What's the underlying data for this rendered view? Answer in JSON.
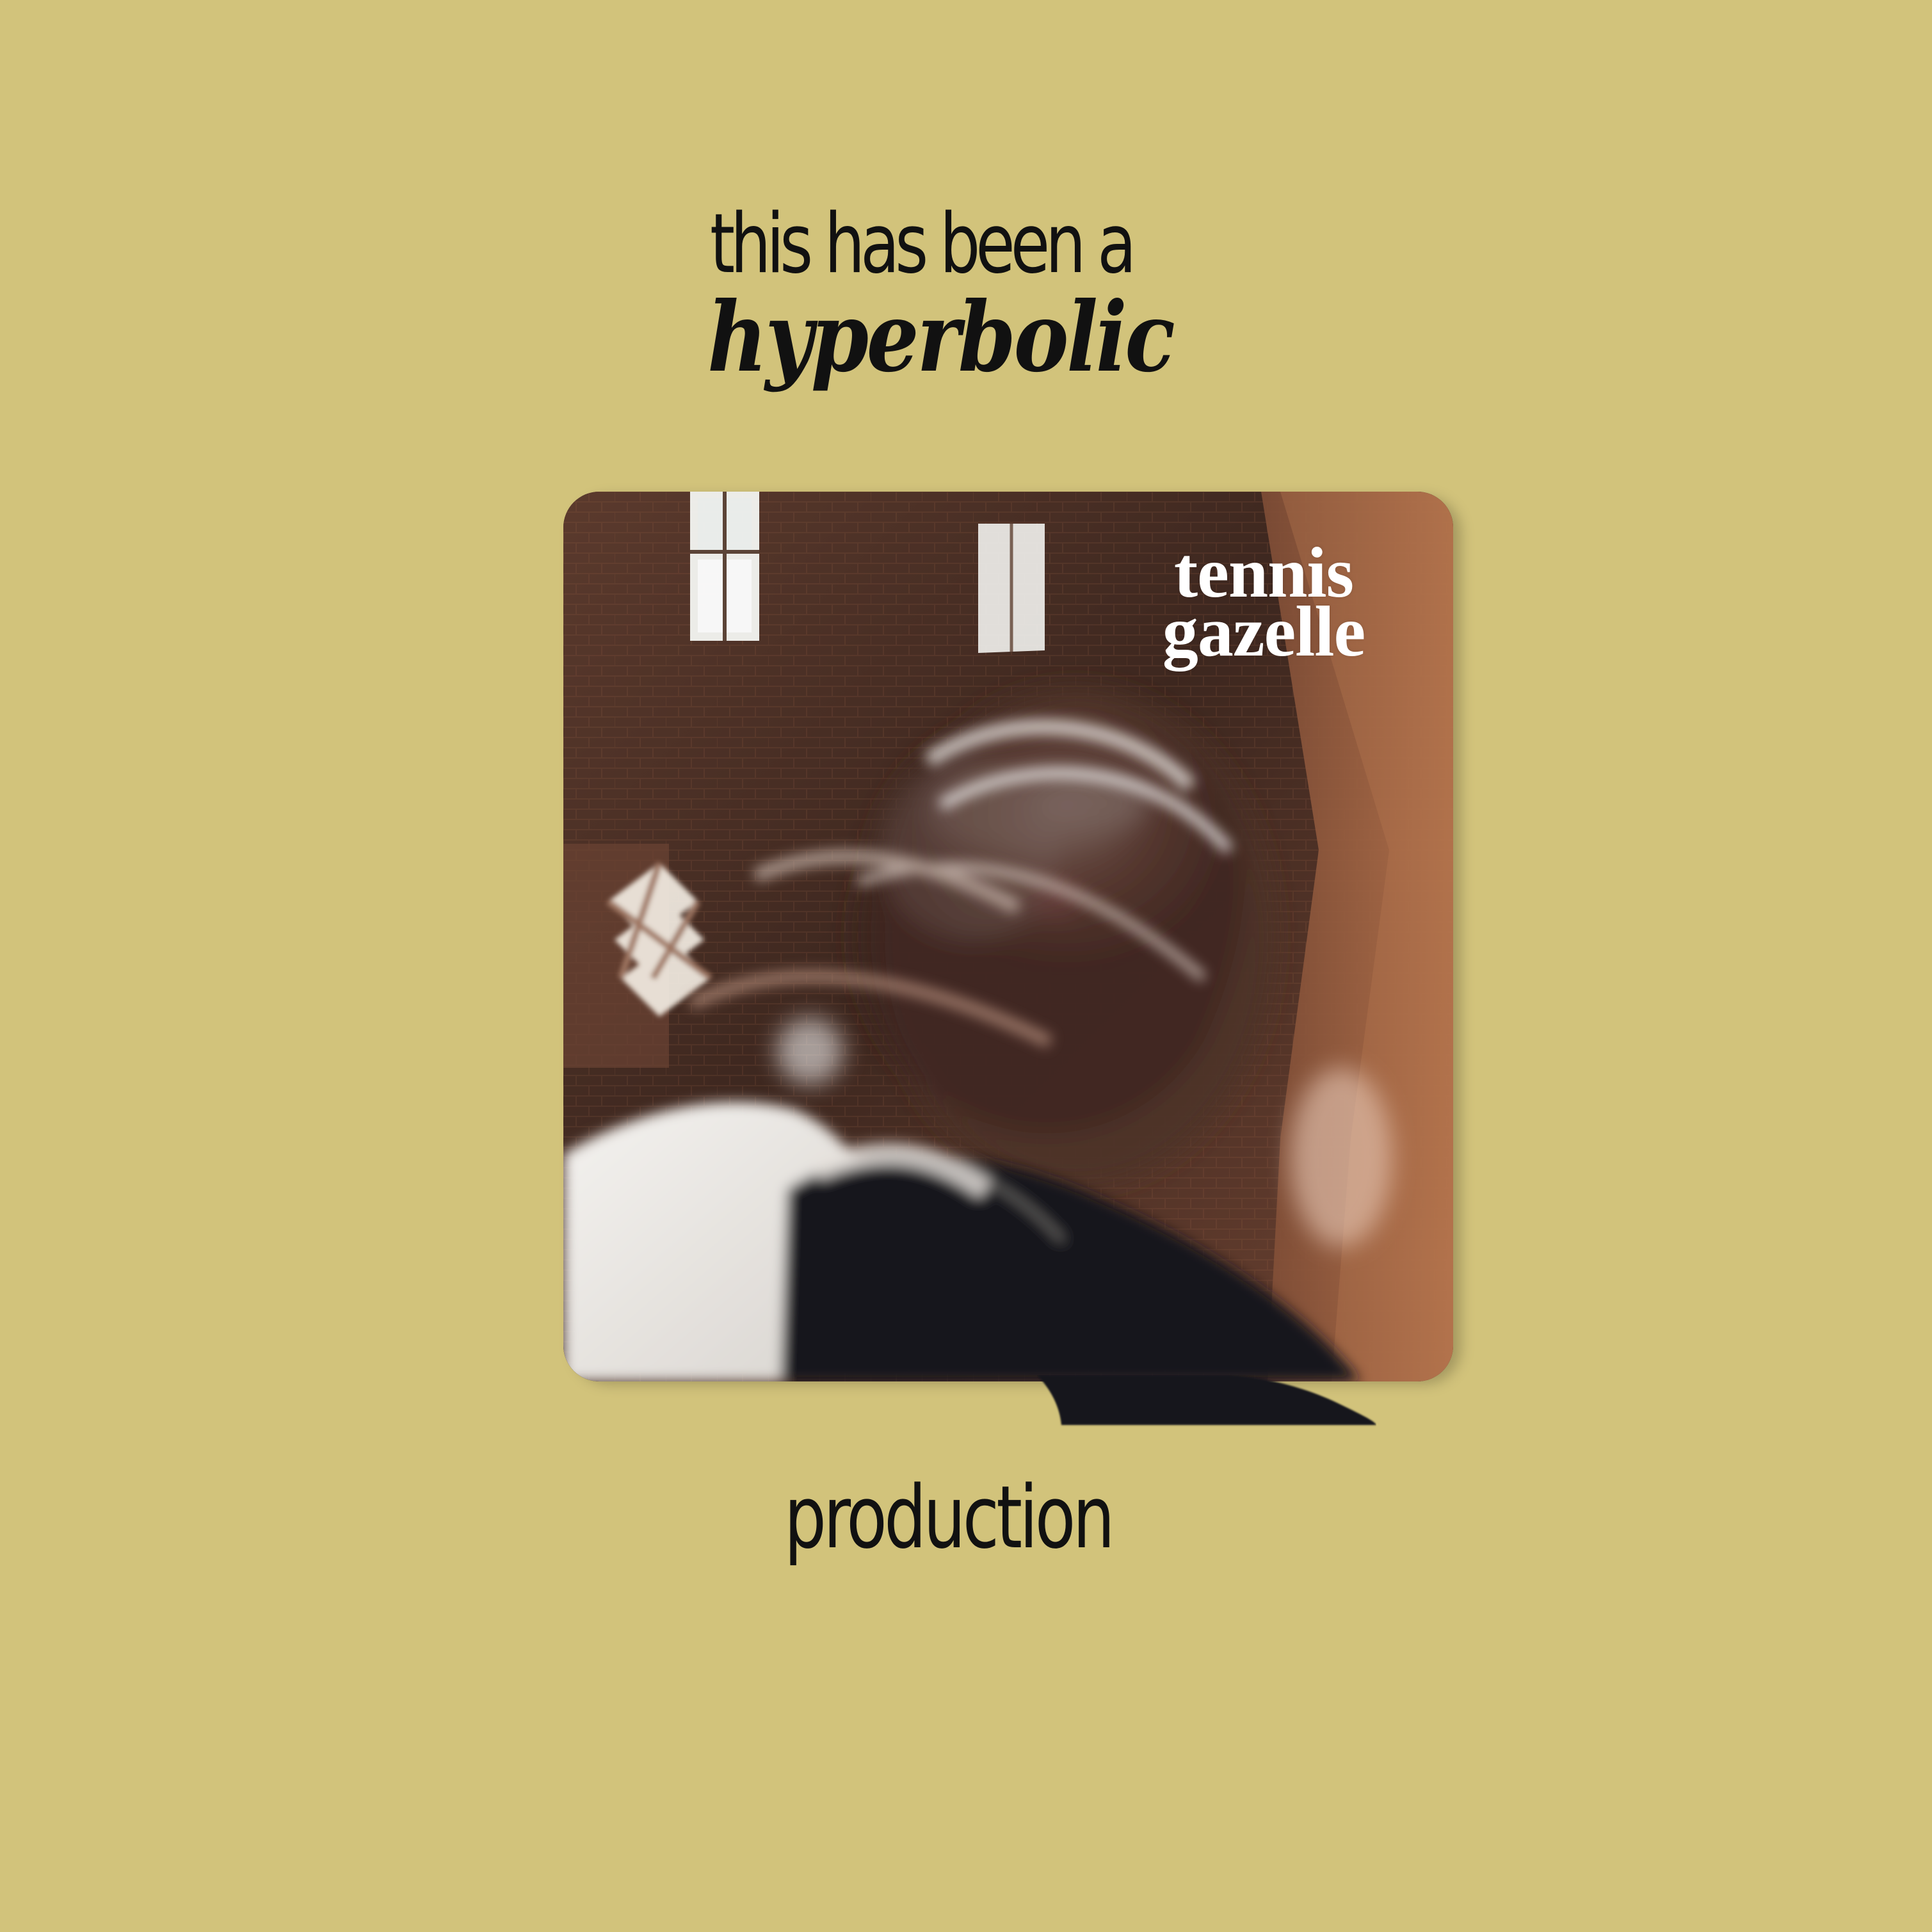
{
  "header": {
    "line1": "this has been a",
    "line2": "hyperbolic"
  },
  "photo": {
    "title": "tennis gazelle"
  },
  "footer": {
    "line1": "production"
  },
  "colors": {
    "background": "#d2c37b",
    "text": "#111111",
    "photo_title": "#ffffff"
  },
  "icons": {
    "photo": "blurred-portrait-photo"
  }
}
